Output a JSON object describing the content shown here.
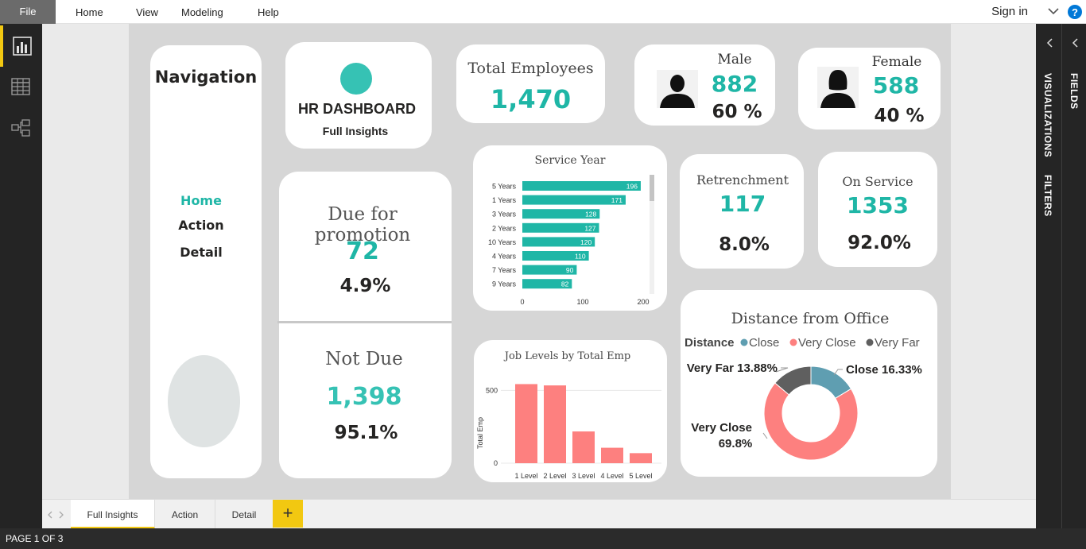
{
  "ribbon": {
    "file": "File",
    "menus": [
      "Home",
      "View",
      "Modeling",
      "Help"
    ],
    "sign_in": "Sign in",
    "help": "?"
  },
  "left_rail": [
    "report-view",
    "data-view",
    "model-view"
  ],
  "right_panes": {
    "visualizations": "VISUALIZATIONS",
    "filters": "FILTERS",
    "fields": "FIELDS"
  },
  "nav": {
    "title": "Navigation",
    "links": [
      "Home",
      "Action",
      "Detail"
    ]
  },
  "header": {
    "title": "HR DASHBOARD",
    "subtitle": "Full Insights"
  },
  "kpi": {
    "total_label": "Total Employees",
    "total_value": "1,470",
    "male_label": "Male",
    "male_value": "882",
    "male_pct": "60 %",
    "female_label": "Female",
    "female_value": "588",
    "female_pct": "40 %",
    "retrench_label": "Retrenchment",
    "retrench_value": "117",
    "retrench_pct": "8.0%",
    "service_label": "On Service",
    "service_value": "1353",
    "service_pct": "92.0%"
  },
  "promotion": {
    "due_label": "Due for promotion",
    "due_value": "72",
    "due_pct": "4.9%",
    "notdue_label": "Not Due",
    "notdue_value": "1,398",
    "notdue_pct": "95.1%"
  },
  "colors": {
    "teal": "#1fb6a6",
    "salmon": "#fd807f",
    "slate": "#5f9eb1",
    "dark": "#5f5f5f"
  },
  "chart_data": [
    {
      "type": "bar",
      "orientation": "horizontal",
      "title": "Service Year",
      "categories": [
        "5 Years",
        "1 Years",
        "3 Years",
        "2 Years",
        "10 Years",
        "4 Years",
        "7 Years",
        "9 Years"
      ],
      "values": [
        196,
        171,
        128,
        127,
        120,
        110,
        90,
        82
      ],
      "xticks": [
        "0",
        "100",
        "200"
      ],
      "xlim": [
        0,
        200
      ]
    },
    {
      "type": "bar",
      "title": "Job Levels by Total Emp",
      "ylabel": "Total Emp",
      "categories": [
        "1 Level",
        "2 Level",
        "3 Level",
        "4 Level",
        "5 Level"
      ],
      "values": [
        543,
        534,
        218,
        106,
        69
      ],
      "yticks": [
        "0",
        "500"
      ],
      "ylim": [
        0,
        600
      ]
    },
    {
      "type": "pie",
      "title": "Distance from Office",
      "legend_title": "Distance",
      "legend": [
        "Close",
        "Very Close",
        "Very Far"
      ],
      "slices": [
        {
          "name": "Close",
          "value": 16.33,
          "label": "Close 16.33%"
        },
        {
          "name": "Very Close",
          "value": 69.8,
          "label_line1": "Very Close",
          "label_line2": "69.8%"
        },
        {
          "name": "Very Far",
          "value": 13.88,
          "label": "Very Far 13.88%"
        }
      ]
    }
  ],
  "pages": [
    "Full Insights",
    "Action",
    "Detail"
  ],
  "add_page": "+",
  "status": "PAGE 1 OF 3"
}
